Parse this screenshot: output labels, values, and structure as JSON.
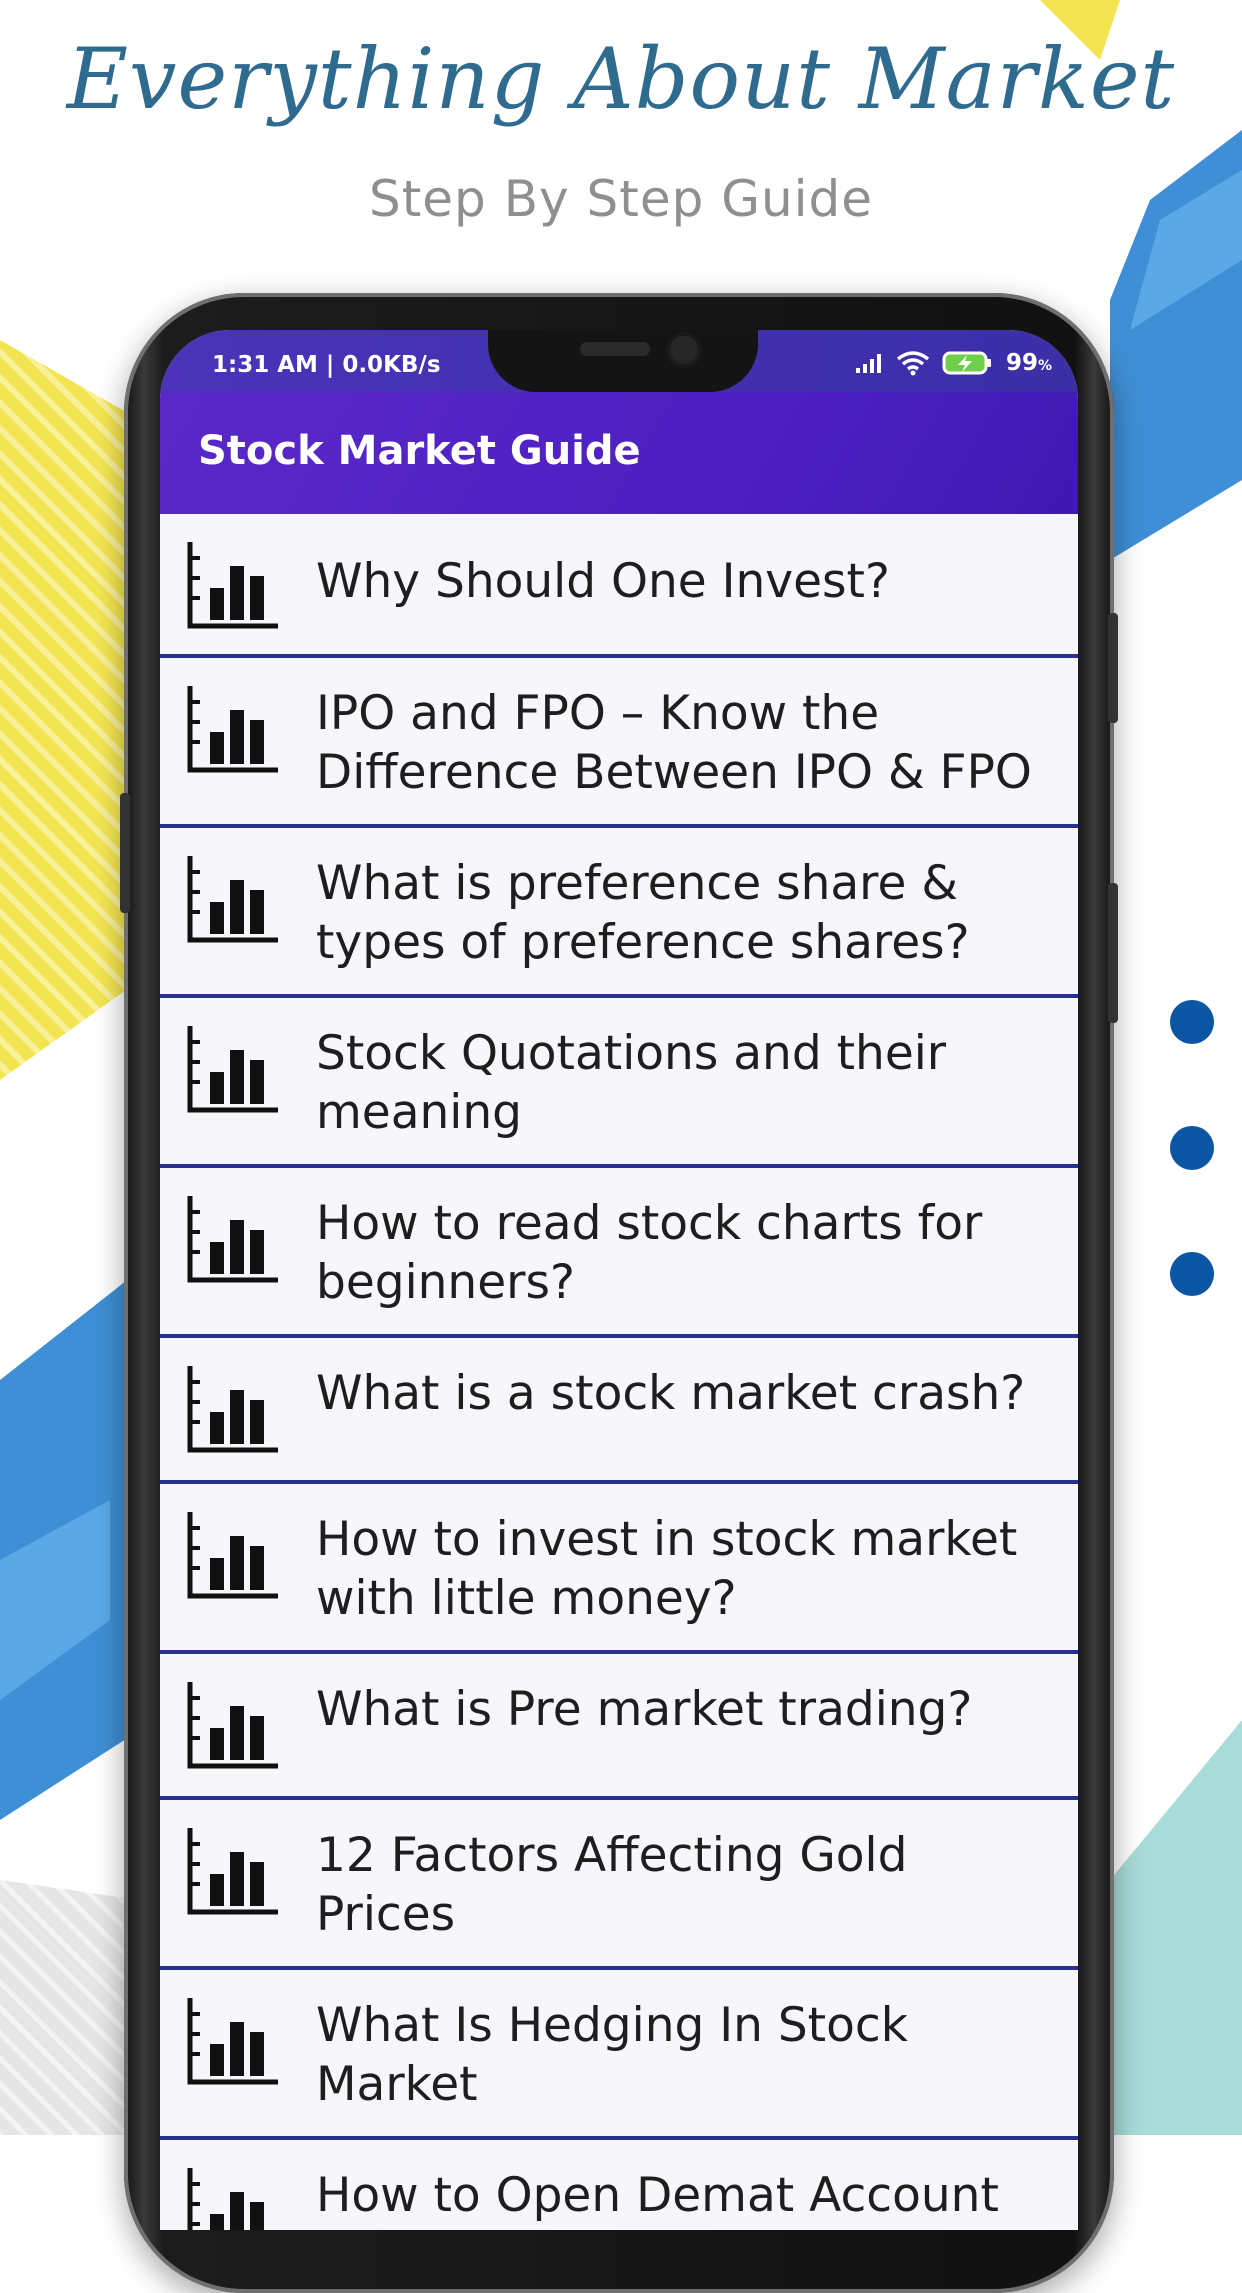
{
  "promo": {
    "headline": "Everything About Market",
    "subheadline": "Step By Step Guide"
  },
  "status_bar": {
    "time": "1:31 AM | 0.0KB/s",
    "battery": "99",
    "battery_unit": "%",
    "icons": [
      "signal-icon",
      "wifi-icon",
      "battery-charging-icon"
    ]
  },
  "app_bar": {
    "title": "Stock Market Guide"
  },
  "list_items": [
    {
      "label": "Why Should One Invest?",
      "icon": "bar-chart-icon"
    },
    {
      "label": "IPO and FPO – Know the Difference Between IPO & FPO",
      "icon": "bar-chart-icon"
    },
    {
      "label": "What is preference share & types of preference shares?",
      "icon": "bar-chart-icon"
    },
    {
      "label": "Stock Quotations and their meaning",
      "icon": "bar-chart-icon"
    },
    {
      "label": "How to read stock charts for beginners?",
      "icon": "bar-chart-icon"
    },
    {
      "label": "What is a stock market crash?",
      "icon": "bar-chart-icon"
    },
    {
      "label": "How to invest in stock market with little money?",
      "icon": "bar-chart-icon"
    },
    {
      "label": "What is Pre market trading?",
      "icon": "bar-chart-icon"
    },
    {
      "label": "12 Factors Affecting Gold Prices",
      "icon": "bar-chart-icon"
    },
    {
      "label": "What Is Hedging In Stock Market",
      "icon": "bar-chart-icon"
    },
    {
      "label": "How to Open Demat Account",
      "icon": "bar-chart-icon"
    }
  ],
  "colors": {
    "app_bar": "#4b1fc0",
    "divider": "#27308e",
    "headline": "#2f6b8f",
    "accent_blue": "#3f8fd6",
    "accent_yellow": "#f5e84a",
    "dot_blue": "#0b56a4"
  }
}
